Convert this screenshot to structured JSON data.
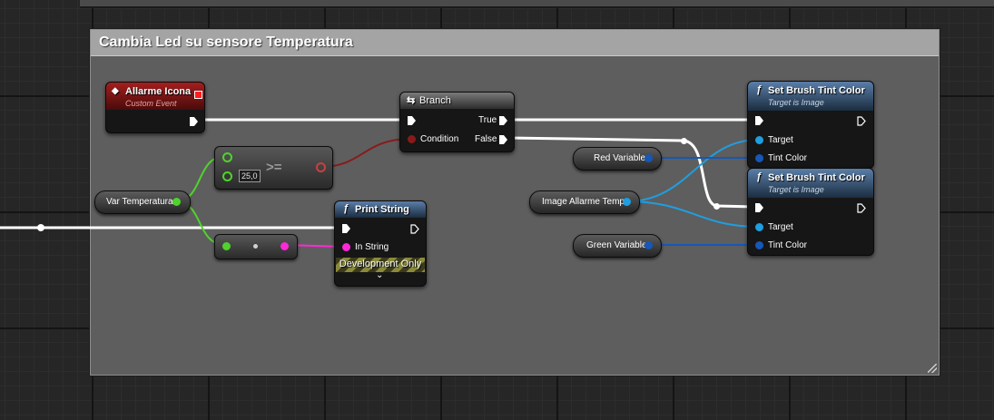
{
  "comment": {
    "title": "Cambia Led su sensore Temperatura"
  },
  "nodes": {
    "event": {
      "title": "Allarme Icona",
      "subtitle": "Custom Event"
    },
    "branch": {
      "title": "Branch",
      "condition": "Condition",
      "true_label": "True",
      "false_label": "False"
    },
    "compare": {
      "operator": ">=",
      "value": "25,0"
    },
    "print": {
      "title": "Print String",
      "in_string": "In String",
      "dev_only": "Development Only"
    },
    "var_temp": {
      "label": "Var Temperatura"
    },
    "red_var": {
      "label": "Red Variable"
    },
    "image_var": {
      "label": "Image Allarme Temp"
    },
    "green_var": {
      "label": "Green Variable"
    },
    "set_tint_1": {
      "title": "Set Brush Tint Color",
      "subtitle": "Target is Image",
      "target": "Target",
      "tint": "Tint Color"
    },
    "set_tint_2": {
      "title": "Set Brush Tint Color",
      "subtitle": "Target is Image",
      "target": "Target",
      "tint": "Tint Color"
    }
  },
  "icons": {
    "function": "ƒ",
    "branch": "⇆",
    "event": "◆",
    "dropdown": "⌄"
  },
  "colors": {
    "exec": "#ffffff",
    "float": "#4fd32c",
    "bool": "#8a1a1a",
    "string": "#ff28d9",
    "object": "#1f9ee0",
    "struct": "#1657b8",
    "event_header": "#a41e1e",
    "function_header": "#5a7ea8"
  }
}
